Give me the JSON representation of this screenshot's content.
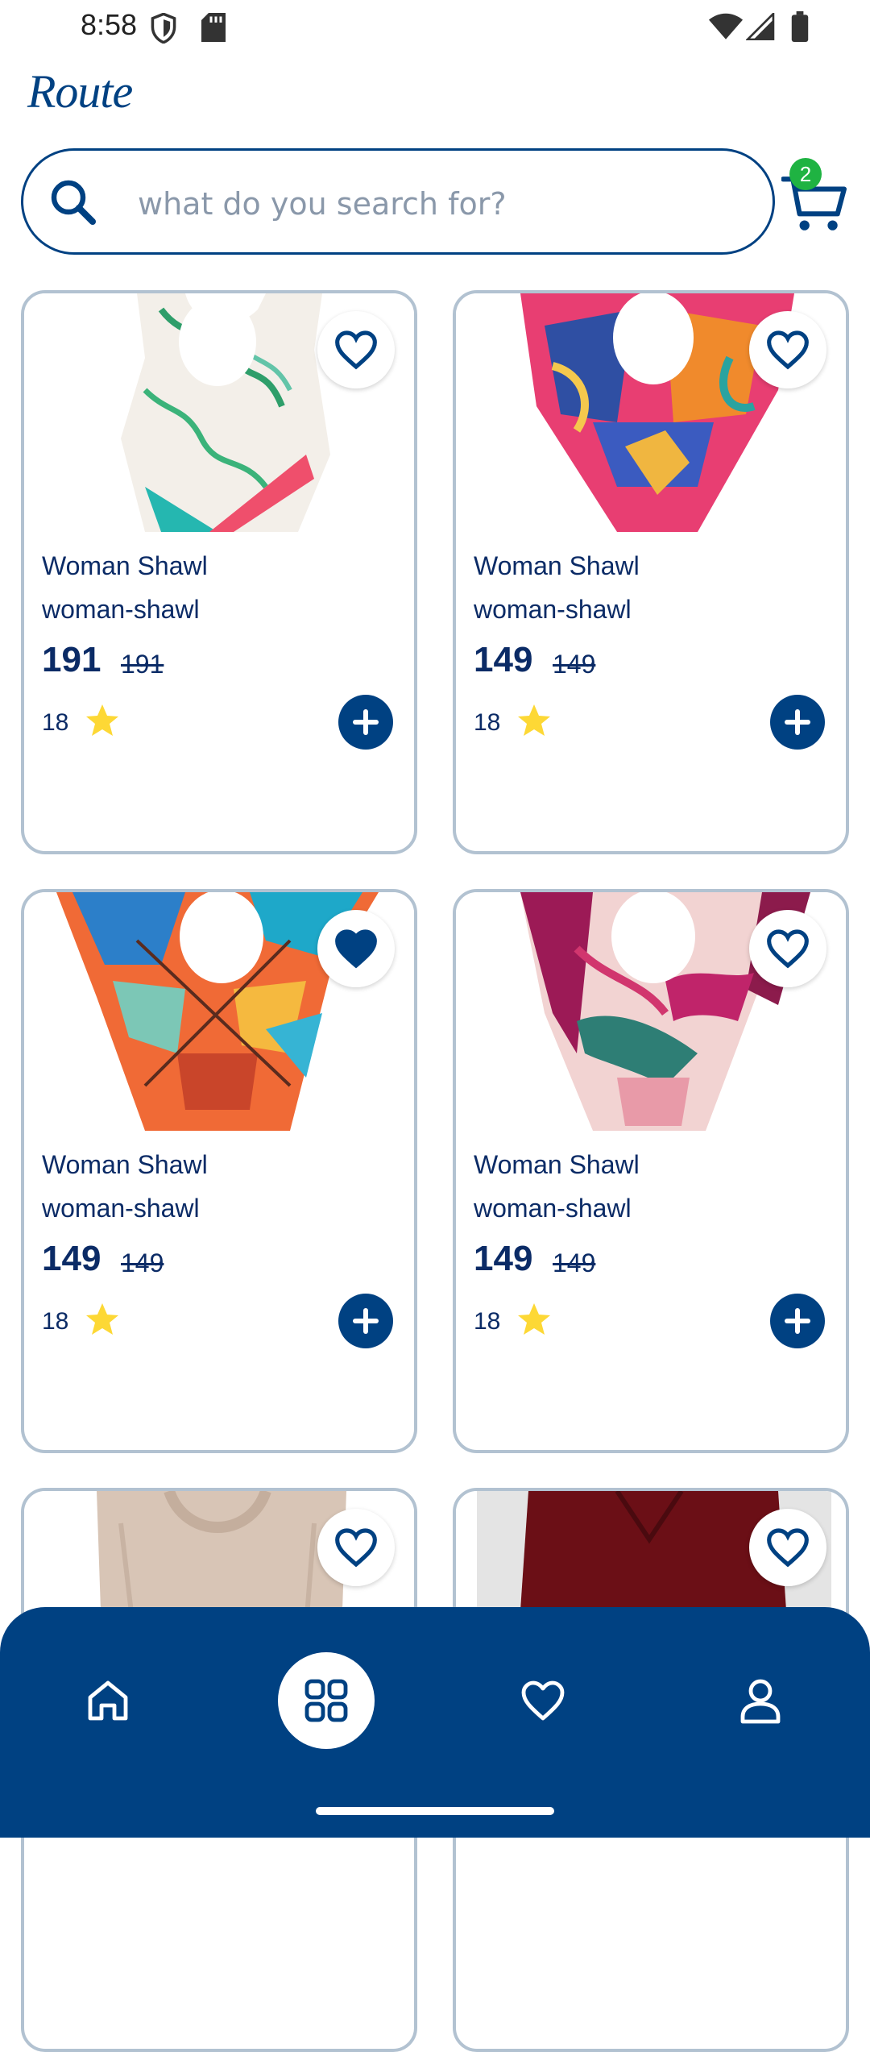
{
  "status_bar": {
    "time": "8:58"
  },
  "header": {
    "logo": "Route"
  },
  "search": {
    "placeholder": "what do you search for?",
    "value": ""
  },
  "cart": {
    "count": "2"
  },
  "colors": {
    "primary": "#004182",
    "badge": "#1fb342",
    "star": "#fdd835",
    "card_border": "#b2c2d1"
  },
  "products": [
    {
      "title": "Woman Shawl",
      "slug": "woman-shawl",
      "price": "191",
      "old_price": "191",
      "rating": "18",
      "favorite": false,
      "image": "floral-white-scarf"
    },
    {
      "title": "Woman Shawl",
      "slug": "woman-shawl",
      "price": "149",
      "old_price": "149",
      "rating": "18",
      "favorite": false,
      "image": "pink-blue-tropical-scarf"
    },
    {
      "title": "Woman Shawl",
      "slug": "woman-shawl",
      "price": "149",
      "old_price": "149",
      "rating": "18",
      "favorite": true,
      "image": "geometric-orange-teal-scarf"
    },
    {
      "title": "Woman Shawl",
      "slug": "woman-shawl",
      "price": "149",
      "old_price": "149",
      "rating": "18",
      "favorite": false,
      "image": "magenta-leaf-scarf"
    },
    {
      "title": "",
      "slug": "",
      "price": "",
      "old_price": "",
      "rating": "",
      "favorite": false,
      "image": "beige-shawl"
    },
    {
      "title": "",
      "slug": "",
      "price": "",
      "old_price": "",
      "rating": "",
      "favorite": false,
      "image": "burgundy-shawl"
    }
  ],
  "bottom_nav": {
    "items": [
      {
        "icon": "home-icon",
        "active": false
      },
      {
        "icon": "categories-icon",
        "active": true
      },
      {
        "icon": "wishlist-icon",
        "active": false
      },
      {
        "icon": "profile-icon",
        "active": false
      }
    ]
  }
}
